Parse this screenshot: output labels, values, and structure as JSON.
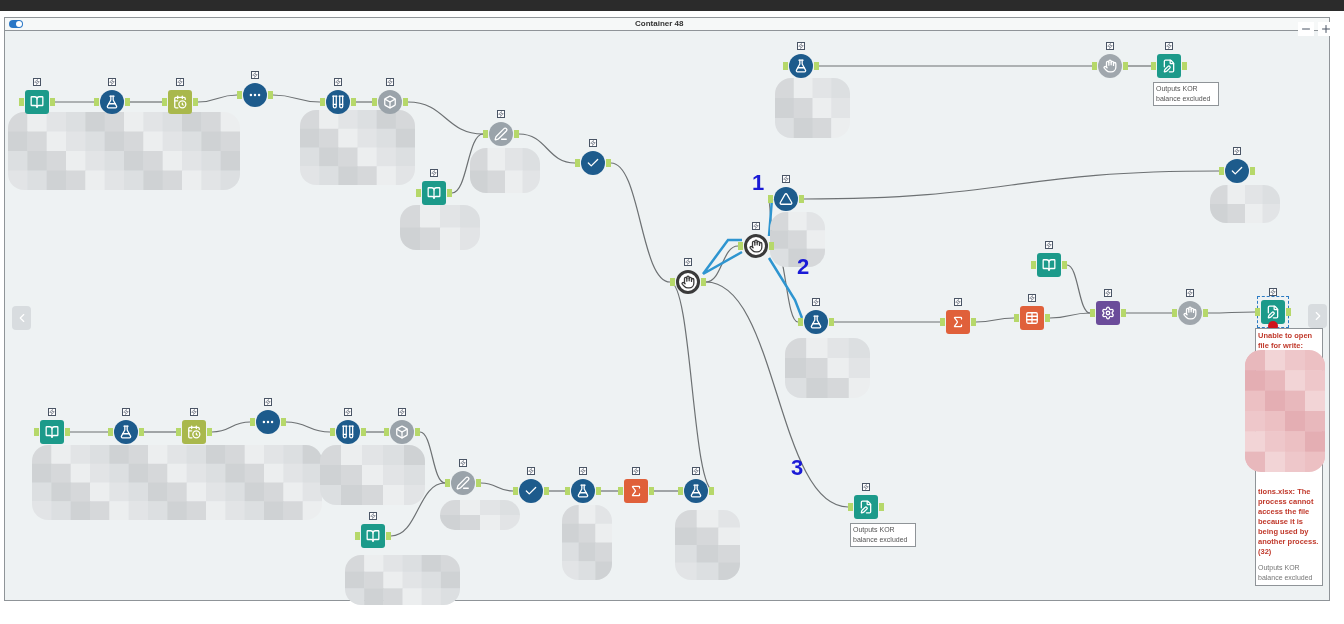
{
  "container": {
    "title": "Container 48",
    "enabled": true
  },
  "nodes": [
    {
      "kind": "input",
      "selected": false,
      "error": false
    },
    {
      "kind": "formula",
      "selected": false,
      "error": false
    },
    {
      "kind": "datetime",
      "selected": false,
      "error": false
    },
    {
      "kind": "unique",
      "selected": false,
      "error": false
    },
    {
      "kind": "multirow",
      "selected": false,
      "error": false
    },
    {
      "kind": "select",
      "selected": false,
      "error": false
    },
    {
      "kind": "findreplace",
      "selected": false,
      "error": false
    },
    {
      "kind": "input",
      "selected": false,
      "error": false
    },
    {
      "kind": "filter",
      "selected": false,
      "error": false
    },
    {
      "kind": "join",
      "selected": false,
      "error": false
    },
    {
      "kind": "join",
      "selected": false,
      "error": false
    },
    {
      "kind": "test",
      "selected": false,
      "error": false
    },
    {
      "kind": "formula",
      "selected": false,
      "error": false
    },
    {
      "kind": "blockuntil",
      "selected": false,
      "error": false
    },
    {
      "kind": "output",
      "selected": false,
      "error": false
    },
    {
      "kind": "filter",
      "selected": false,
      "error": false
    },
    {
      "kind": "formula",
      "selected": false,
      "error": false
    },
    {
      "kind": "summarize",
      "selected": false,
      "error": false
    },
    {
      "kind": "crosstab",
      "selected": false,
      "error": false
    },
    {
      "kind": "input",
      "selected": false,
      "error": false
    },
    {
      "kind": "macro",
      "selected": false,
      "error": false
    },
    {
      "kind": "blockuntil",
      "selected": false,
      "error": false
    },
    {
      "kind": "output",
      "selected": true,
      "error": true
    },
    {
      "kind": "input",
      "selected": false,
      "error": false
    },
    {
      "kind": "formula",
      "selected": false,
      "error": false
    },
    {
      "kind": "datetime",
      "selected": false,
      "error": false
    },
    {
      "kind": "unique",
      "selected": false,
      "error": false
    },
    {
      "kind": "multirow",
      "selected": false,
      "error": false
    },
    {
      "kind": "select",
      "selected": false,
      "error": false
    },
    {
      "kind": "findreplace",
      "selected": false,
      "error": false
    },
    {
      "kind": "input",
      "selected": false,
      "error": false
    },
    {
      "kind": "filter",
      "selected": false,
      "error": false
    },
    {
      "kind": "formula",
      "selected": false,
      "error": false
    },
    {
      "kind": "summarize",
      "selected": false,
      "error": false
    },
    {
      "kind": "formula",
      "selected": false,
      "error": false
    },
    {
      "kind": "output",
      "selected": false,
      "error": false
    }
  ],
  "annotations": [
    {
      "text": "Outputs KOR balance excluded"
    },
    {
      "text": "Outputs KOR balance excluded"
    }
  ],
  "error_note": {
    "message_start": "Unable to open file for write:",
    "message_end": "tions.xlsx: The process cannot access the file because it is being used by another process. (32)",
    "annotation": "Outputs KOR balance excluded"
  },
  "markers": [
    "1",
    "2",
    "3"
  ]
}
